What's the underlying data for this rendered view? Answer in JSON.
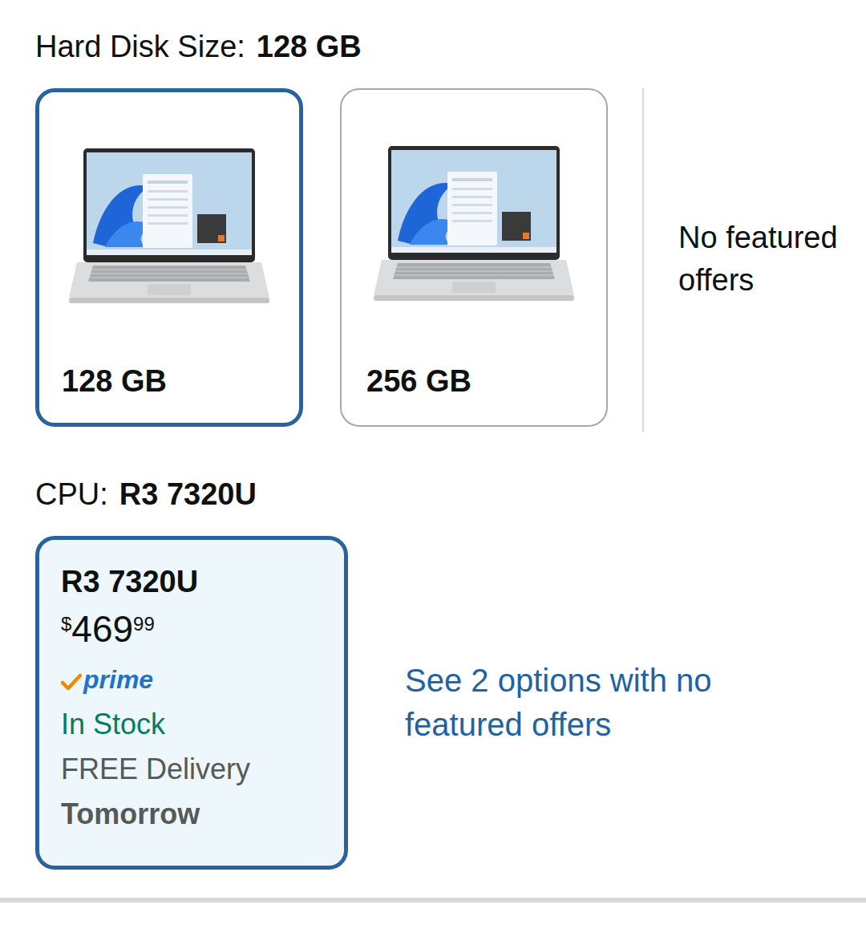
{
  "hard_disk": {
    "label": "Hard Disk Size:",
    "value": "128 GB",
    "options": [
      {
        "label": "128 GB",
        "selected": true
      },
      {
        "label": "256 GB",
        "selected": false
      }
    ],
    "no_offers": "No featured offers"
  },
  "cpu": {
    "label": "CPU:",
    "value": "R3 7320U",
    "options": [
      {
        "label": "R3 7320U",
        "selected": true,
        "price": {
          "symbol": "$",
          "whole": "469",
          "fraction": "99"
        },
        "prime": "prime",
        "availability": "In Stock",
        "delivery": "FREE Delivery",
        "delivery_date": "Tomorrow"
      }
    ],
    "more_link": "See 2 options with no featured offers"
  }
}
